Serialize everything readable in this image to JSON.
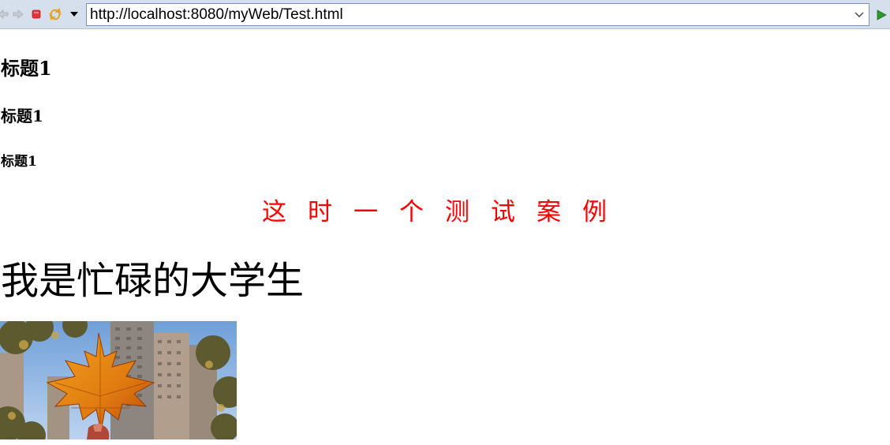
{
  "toolbar": {
    "url": "http://localhost:8080/myWeb/Test.html",
    "icons": [
      "back-icon",
      "forward-icon",
      "stop-icon",
      "refresh-icon",
      "menu-dropdown-icon",
      "url-dropdown-icon",
      "go-icon"
    ],
    "colors": {
      "bar": "#d6e0ec",
      "stop": "#e8303a",
      "refresh": "#e6a21b",
      "go": "#2c9a2c"
    }
  },
  "page": {
    "heading_h3": "标题1",
    "heading_h4": "标题1",
    "heading_h5": "标题1",
    "center_text": "这时一个测试案例",
    "center_text_color": "#ff0000",
    "big_text": "我是忙碌的大学生",
    "image": "maple-leaf-photo"
  }
}
